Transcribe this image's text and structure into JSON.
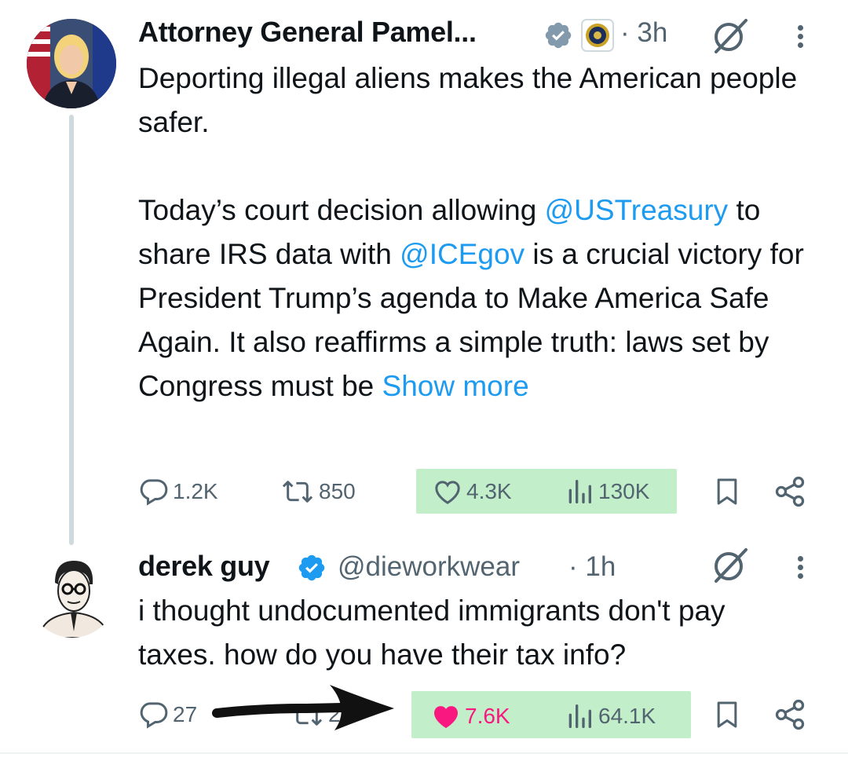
{
  "tweet1": {
    "display_name": "Attorney General Pamel...",
    "time": "· 3h",
    "text_intro": "Deporting illegal aliens makes the American people safer.",
    "text_p2_a": "Today’s court decision allowing ",
    "mention_1": "@USTreasury",
    "text_p2_b": " to share IRS data with ",
    "mention_2": "@ICEgov",
    "text_p2_c": " is a crucial victory for President Trump’s agenda to Make America Safe Again. It also reaffirms a simple truth: laws set by Congress must be ",
    "show_more": "Show more",
    "replies": "1.2K",
    "reposts": "850",
    "likes": "4.3K",
    "views": "130K"
  },
  "tweet2": {
    "display_name": "derek guy",
    "handle": "@dieworkwear",
    "time": "· 1h",
    "text": "i thought undocumented immigrants don't pay taxes. how do you have their tax info?",
    "replies": "27",
    "reposts": "24",
    "likes": "7.6K",
    "views": "64.1K"
  },
  "colors": {
    "link": "#1d9bf0",
    "verified": "#1d9bf0",
    "like_active": "#f91880",
    "highlight": "#b7ebbf",
    "muted": "#536471"
  },
  "icons": [
    "verified-badge-icon",
    "doj-seal-icon",
    "grok-icon",
    "more-icon",
    "reply-icon",
    "repost-icon",
    "like-icon",
    "views-icon",
    "bookmark-icon",
    "share-icon"
  ]
}
